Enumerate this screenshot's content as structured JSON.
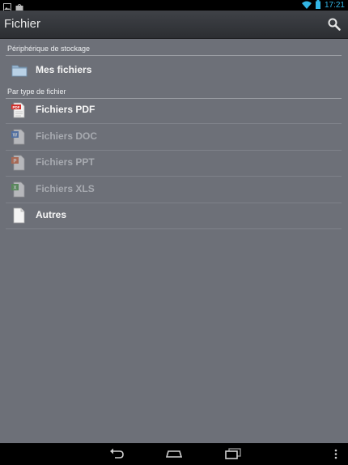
{
  "status_bar": {
    "time": "17:21",
    "left_icons": [
      "image-notification-icon",
      "store-notification-icon"
    ],
    "right_icons": [
      "wifi-icon",
      "battery-icon"
    ]
  },
  "action_bar": {
    "title": "Fichier",
    "search_icon": "search-icon"
  },
  "sections": {
    "storage": {
      "header": "Périphérique de stockage",
      "items": [
        {
          "label": "Mes fichiers",
          "icon": "folder-icon",
          "enabled": true
        }
      ]
    },
    "by_type": {
      "header": "Par type de fichier",
      "items": [
        {
          "label": "Fichiers PDF",
          "icon": "pdf-file-icon",
          "enabled": true
        },
        {
          "label": "Fichiers DOC",
          "icon": "doc-file-icon",
          "enabled": false
        },
        {
          "label": "Fichiers PPT",
          "icon": "ppt-file-icon",
          "enabled": false
        },
        {
          "label": "Fichiers XLS",
          "icon": "xls-file-icon",
          "enabled": false
        },
        {
          "label": "Autres",
          "icon": "generic-file-icon",
          "enabled": true
        }
      ]
    }
  },
  "nav_bar": {
    "buttons": [
      "back-icon",
      "home-icon",
      "recent-apps-icon",
      "overflow-menu-icon"
    ]
  },
  "colors": {
    "accent": "#33b5e5",
    "content_background": "#6d7078",
    "action_bar": "#35373b",
    "pdf_red": "#d2302c",
    "doc_blue": "#3b6fc3",
    "ppt_orange": "#d7653a",
    "xls_green": "#4a9a46"
  }
}
